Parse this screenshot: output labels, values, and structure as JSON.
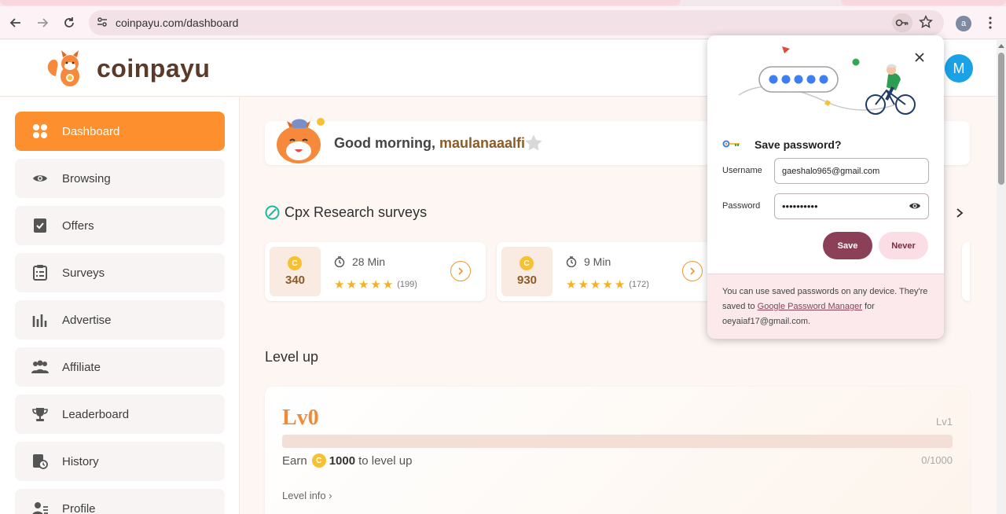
{
  "browser": {
    "url": "coinpayu.com/dashboard",
    "profile_initial": "a"
  },
  "site": {
    "logo_text": "coinpayu",
    "avatar_initial": "M"
  },
  "sidebar": {
    "items": [
      {
        "label": "Dashboard",
        "icon": "dashboard-icon",
        "active": true
      },
      {
        "label": "Browsing",
        "icon": "eye-icon"
      },
      {
        "label": "Offers",
        "icon": "offers-icon"
      },
      {
        "label": "Surveys",
        "icon": "clipboard-icon"
      },
      {
        "label": "Advertise",
        "icon": "bar-chart-icon"
      },
      {
        "label": "Affiliate",
        "icon": "people-icon"
      },
      {
        "label": "Leaderboard",
        "icon": "trophy-icon"
      },
      {
        "label": "History",
        "icon": "history-icon"
      },
      {
        "label": "Profile",
        "icon": "profile-icon"
      }
    ]
  },
  "greeting": {
    "prefix": "Good morning, ",
    "username": "maulanaaalfi"
  },
  "cpx": {
    "title": "Cpx Research surveys",
    "cards": [
      {
        "coins": "340",
        "time": "28 Min",
        "rating_count": "(199)",
        "stars": 5
      },
      {
        "coins": "930",
        "time": "9 Min",
        "rating_count": "(172)",
        "stars": 5
      }
    ]
  },
  "level": {
    "section_title": "Level up",
    "current": "Lv0",
    "next": "Lv1",
    "earn_prefix": "Earn",
    "earn_amount": "1000",
    "earn_suffix": "to level up",
    "progress_text": "0/1000",
    "progress_fraction": 0,
    "info_link": "Level info ›"
  },
  "password_popup": {
    "title": "Save password?",
    "username_label": "Username",
    "username_value": "gaeshalo965@gmail.com",
    "password_label": "Password",
    "password_value": "••••••••••",
    "save_label": "Save",
    "never_label": "Never",
    "footer_pre": "You can use saved passwords on any device. They're saved to ",
    "footer_link": "Google Password Manager",
    "footer_post": " for oeyaiaf17@gmail.com."
  },
  "colors": {
    "accent": "#fe8f2e",
    "brand_brown": "#5b3a29",
    "popup_primary": "#8c4058"
  }
}
